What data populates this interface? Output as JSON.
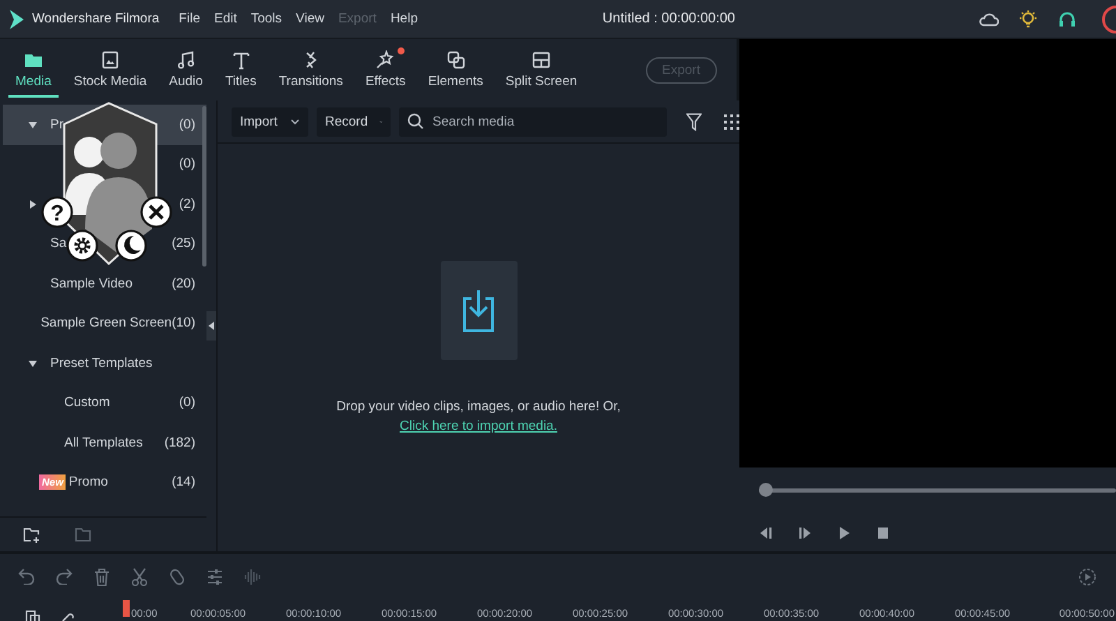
{
  "app": {
    "name": "Wondershare Filmora"
  },
  "menu": [
    {
      "label": "File",
      "disabled": false
    },
    {
      "label": "Edit",
      "disabled": false
    },
    {
      "label": "Tools",
      "disabled": false
    },
    {
      "label": "View",
      "disabled": false
    },
    {
      "label": "Export",
      "disabled": true
    },
    {
      "label": "Help",
      "disabled": false
    }
  ],
  "project_title": "Untitled : 00:00:00:00",
  "tabs": [
    {
      "label": "Media",
      "selected": true,
      "notification": false
    },
    {
      "label": "Stock Media",
      "selected": false,
      "notification": false
    },
    {
      "label": "Audio",
      "selected": false,
      "notification": false
    },
    {
      "label": "Titles",
      "selected": false,
      "notification": false
    },
    {
      "label": "Transitions",
      "selected": false,
      "notification": false
    },
    {
      "label": "Effects",
      "selected": false,
      "notification": true
    },
    {
      "label": "Elements",
      "selected": false,
      "notification": false
    },
    {
      "label": "Split Screen",
      "selected": false,
      "notification": false
    }
  ],
  "export_button": {
    "label": "Export",
    "disabled": true
  },
  "media_toolbar": {
    "import": "Import",
    "record": "Record",
    "search": {
      "placeholder": "Search media"
    }
  },
  "sidebar": {
    "items": [
      {
        "kind": "group",
        "label": "Pr",
        "count": "(0)",
        "expanded": true,
        "selected": true,
        "children": [
          {
            "kind": "item",
            "count": "(0)",
            "selected": false
          }
        ]
      },
      {
        "kind": "group",
        "count": "(2)",
        "expanded": false,
        "selected": false
      },
      {
        "kind": "item",
        "label": "Sa",
        "count": "(25)",
        "selected": false
      },
      {
        "kind": "item",
        "label": "Sample Video",
        "count": "(20)",
        "selected": false
      },
      {
        "kind": "item",
        "label": "Sample Green Screen",
        "count": "(10)",
        "selected": false
      },
      {
        "kind": "group",
        "label": "Preset Templates",
        "expanded": true,
        "selected": false,
        "children": [
          {
            "kind": "item",
            "label": "Custom",
            "count": "(0)",
            "selected": false
          },
          {
            "kind": "item",
            "label": "All Templates",
            "count": "(182)",
            "selected": false
          }
        ]
      },
      {
        "kind": "item",
        "badge": "New",
        "label": "Promo",
        "count": "(14)",
        "selected": false
      }
    ]
  },
  "overlay": {
    "help_glyph": "?"
  },
  "drop_zone": {
    "message": "Drop your video clips, images, or audio here! Or,",
    "link": "Click here to import media."
  },
  "preview": {
    "scrubber": {
      "level": 0
    }
  },
  "timeline": {
    "ruler": [
      "00:00",
      "00:00:05:00",
      "00:00:10:00",
      "00:00:15:00",
      "00:00:20:00",
      "00:00:25:00",
      "00:00:30:00",
      "00:00:35:00",
      "00:00:40:00",
      "00:00:45:00",
      "00:00:50:00"
    ]
  }
}
